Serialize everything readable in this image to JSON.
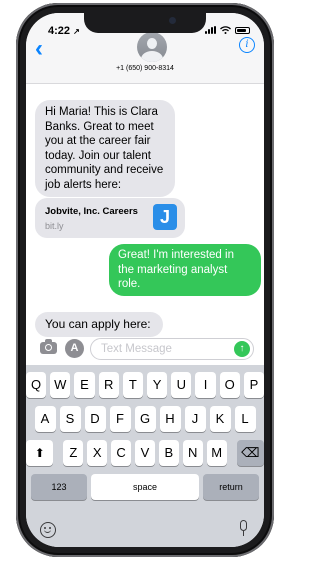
{
  "status_bar": {
    "time": "4:22",
    "location_glyph": "↗"
  },
  "header": {
    "back_glyph": "‹",
    "contact": "+1 (650) 900-8314",
    "info_glyph": "i",
    "icons": [
      "chevron-left-icon",
      "person-avatar-icon",
      "info-icon"
    ]
  },
  "messages": {
    "incoming_1": "Hi Maria! This is Clara Banks. Great to meet you at the career fair today. Join our talent community and receive job alerts here:",
    "link_preview": {
      "title": "Jobvite, Inc. Careers",
      "url": "bit.ly",
      "logo_letter": "J"
    },
    "outgoing_1": "Great! I'm interested in the marketing analyst role.",
    "incoming_2": "You can apply here:"
  },
  "compose": {
    "placeholder": "Text Message",
    "value": "",
    "send_glyph": "↑",
    "appstore_glyph": "A"
  },
  "keyboard": {
    "row1": [
      "Q",
      "W",
      "E",
      "R",
      "T",
      "Y",
      "U",
      "I",
      "O",
      "P"
    ],
    "row2": [
      "A",
      "S",
      "D",
      "F",
      "G",
      "H",
      "J",
      "K",
      "L"
    ],
    "row3": [
      "Z",
      "X",
      "C",
      "V",
      "B",
      "N",
      "M"
    ],
    "shift_glyph": "⬆",
    "backspace_glyph": "⌫",
    "numbers_label": "123",
    "space_label": "space",
    "return_label": "return"
  },
  "colors": {
    "outgoing_bubble": "#34c759",
    "incoming_bubble": "#e5e5ea",
    "accent": "#0a84ff"
  }
}
